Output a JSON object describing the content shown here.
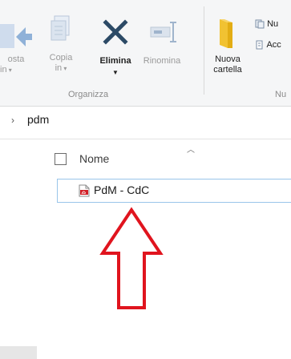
{
  "ribbon": {
    "buttons": [
      {
        "id": "incolla",
        "line1": "osta",
        "line2": "in"
      },
      {
        "id": "copia",
        "line1": "Copia",
        "line2": "in"
      },
      {
        "id": "elimina",
        "line1": "Elimina"
      },
      {
        "id": "rinomina",
        "line1": "Rinomina"
      },
      {
        "id": "nuova",
        "line1": "Nuova",
        "line2": "cartella"
      }
    ],
    "side_items": [
      "Nu",
      "Acc"
    ],
    "groups": {
      "organizza": "Organizza",
      "nuovo": "Nu"
    }
  },
  "address": {
    "path": "pdm"
  },
  "list": {
    "column_name": "Nome",
    "files": [
      {
        "name": "PdM - CdC",
        "type": "pdf"
      }
    ]
  },
  "colors": {
    "arrow": "#e0141e",
    "selection_border": "#99c5ea",
    "delete_icon": "#2c4a66"
  }
}
